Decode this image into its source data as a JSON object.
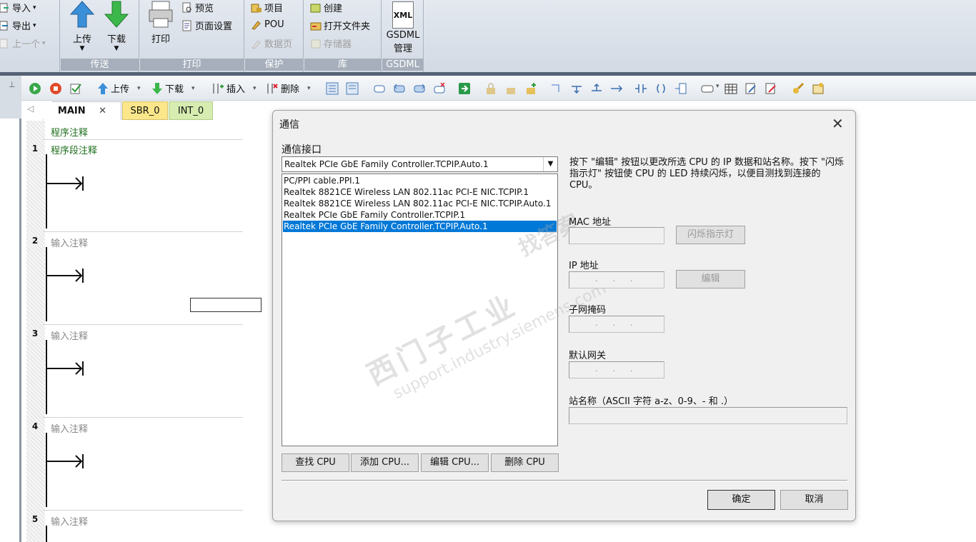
{
  "ribbon": {
    "left_items": {
      "import": "导入",
      "export": "导出",
      "prev": "上一个"
    },
    "transfer": {
      "upload": "上传",
      "download": "下载",
      "title": "传送"
    },
    "print": {
      "print": "打印",
      "preview": "预览",
      "page_setup": "页面设置",
      "title": "打印"
    },
    "protect": {
      "project": "项目",
      "pou": "POU",
      "data_page": "数据页",
      "title": "保护"
    },
    "library": {
      "create": "创建",
      "open_folder": "打开文件夹",
      "memory": "存储器",
      "title": "库"
    },
    "gsdml": {
      "icon_text": "XML",
      "manage": "GSDML\n管理",
      "title": "GSDML"
    }
  },
  "toolbar": {
    "upload": "上传",
    "download": "下载",
    "insert": "插入",
    "delete": "删除"
  },
  "tabs": [
    {
      "label": "MAIN",
      "color": "#ffffff"
    },
    {
      "label": "SBR_0",
      "color": "#fbe68a"
    },
    {
      "label": "INT_0",
      "color": "#d6ecb0"
    }
  ],
  "editor": {
    "program_comment": "程序注释",
    "networks": [
      {
        "num": "1",
        "comment": "程序段注释"
      },
      {
        "num": "2",
        "comment": "输入注释"
      },
      {
        "num": "3",
        "comment": "输入注释"
      },
      {
        "num": "4",
        "comment": "输入注释"
      },
      {
        "num": "5",
        "comment": "输入注释"
      }
    ]
  },
  "dialog": {
    "title": "通信",
    "interface_label": "通信接口",
    "selected_interface": "Realtek PCIe GbE Family Controller.TCPIP.Auto.1",
    "interfaces": [
      "PC/PPI cable.PPI.1",
      "Realtek 8821CE Wireless LAN 802.11ac PCI-E NIC.TCPIP.1",
      "Realtek 8821CE Wireless LAN 802.11ac PCI-E NIC.TCPIP.Auto.1",
      "Realtek PCIe GbE Family Controller.TCPIP.1",
      "Realtek PCIe GbE Family Controller.TCPIP.Auto.1"
    ],
    "selected_index": 4,
    "info_text": "按下 \"编辑\" 按钮以更改所选 CPU 的 IP 数据和站名称。按下 \"闪烁指示灯\" 按钮使 CPU 的 LED 持续闪烁，以便目测找到连接的 CPU。",
    "mac_label": "MAC 地址",
    "blink_button": "闪烁指示灯",
    "ip_label": "IP 地址",
    "edit_button": "编辑",
    "subnet_label": "子网掩码",
    "gateway_label": "默认网关",
    "station_label": "站名称（ASCII 字符 a-z、0-9、- 和 .）",
    "ip_placeholder": ".      .      .",
    "buttons": {
      "find": "查找 CPU",
      "add": "添加 CPU...",
      "edit": "编辑 CPU...",
      "delete": "删除 CPU"
    },
    "ok": "确定",
    "cancel": "取消",
    "watermark1": "西门子工业",
    "watermark2": "support.industry.siemens.com",
    "watermark3": "找答案"
  },
  "colors": {
    "selection": "#0078d7",
    "accent": "#1e5aa8"
  }
}
